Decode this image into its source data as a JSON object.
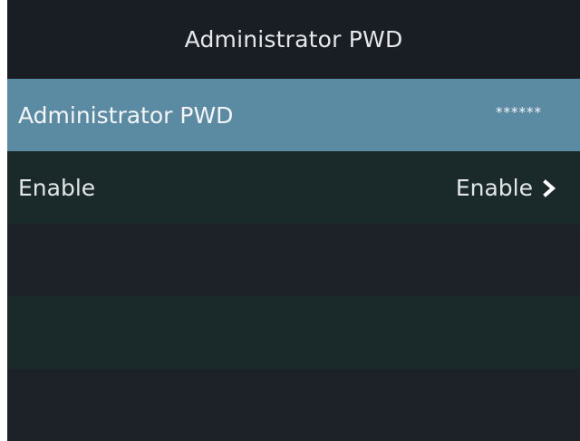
{
  "header": {
    "title": "Administrator PWD"
  },
  "rows": [
    {
      "label": "Administrator PWD",
      "value": "******",
      "selected": true
    },
    {
      "label": "Enable",
      "value": "Enable",
      "has_chevron": true
    }
  ],
  "icons": {
    "chevron": "chevron-right-icon"
  },
  "colors": {
    "selected_row": "#5b8aa3",
    "background": "#1c2228",
    "alt_row": "#1a2a2a",
    "text": "#e3e6e8"
  }
}
